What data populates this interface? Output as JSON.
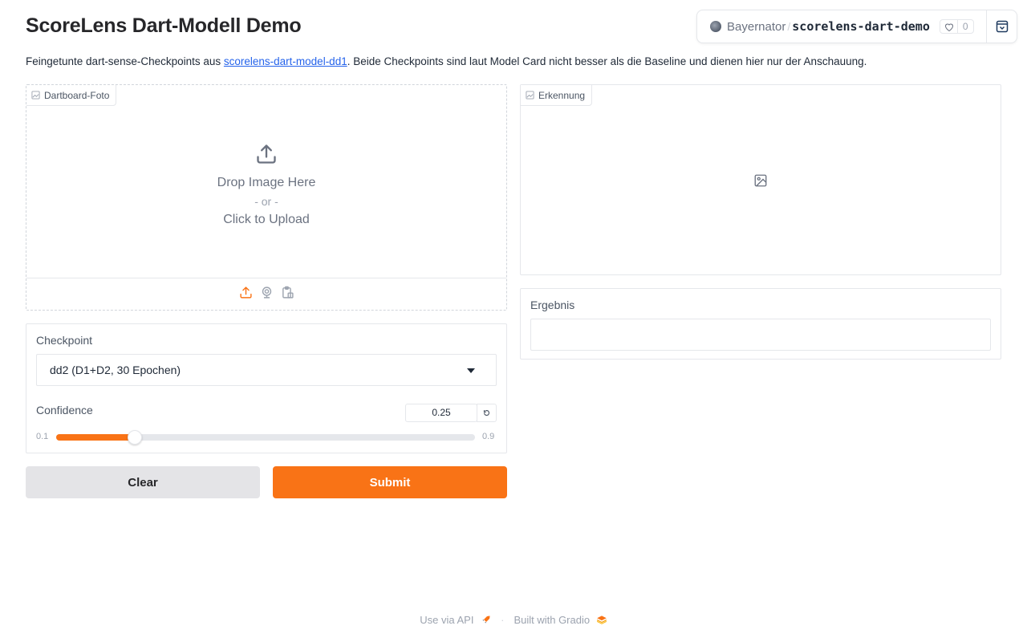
{
  "page": {
    "title": "ScoreLens Dart-Modell Demo",
    "description_before": "Feingetunte dart-sense-Checkpoints aus ",
    "description_link": "scorelens-dart-model-dd1",
    "description_after": ". Beide Checkpoints sind laut Model Card nicht besser als die Baseline und dienen hier nur der Anschauung."
  },
  "hf_header": {
    "owner": "Bayernator",
    "separator": "/",
    "repo": "scorelens-dart-demo",
    "likes": "0"
  },
  "input_image": {
    "label": "Dartboard-Foto",
    "drop_text": "Drop Image Here",
    "or_text": "- or -",
    "click_text": "Click to Upload",
    "toolbar_icons": [
      "upload-icon",
      "webcam-icon",
      "clipboard-icon"
    ]
  },
  "output_image": {
    "label": "Erkennung"
  },
  "result": {
    "label": "Ergebnis",
    "value": ""
  },
  "checkpoint": {
    "label": "Checkpoint",
    "selected": "dd2 (D1+D2, 30 Epochen)"
  },
  "confidence": {
    "label": "Confidence",
    "value": "0.25",
    "min": "0.1",
    "max": "0.9",
    "fill_fraction": 0.1875
  },
  "buttons": {
    "clear": "Clear",
    "submit": "Submit"
  },
  "footer": {
    "api_text": "Use via API",
    "separator": "·",
    "built_text": "Built with Gradio"
  },
  "colors": {
    "accent": "#f97316",
    "link": "#2563eb"
  }
}
